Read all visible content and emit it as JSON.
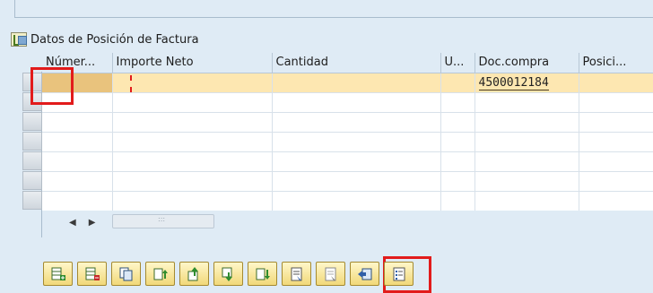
{
  "section": {
    "title": "Datos de Posición de Factura",
    "icon": "tree-structure-icon"
  },
  "table": {
    "columns": [
      "Númer...",
      "Importe Neto",
      "Cantidad",
      "U...",
      "Doc.compra",
      "Posici..."
    ],
    "rows": [
      [
        "",
        "",
        "",
        "",
        "4500012184",
        ""
      ],
      [
        "",
        "",
        "",
        "",
        "",
        ""
      ],
      [
        "",
        "",
        "",
        "",
        "",
        ""
      ],
      [
        "",
        "",
        "",
        "",
        "",
        ""
      ],
      [
        "",
        "",
        "",
        "",
        "",
        ""
      ],
      [
        "",
        "",
        "",
        "",
        "",
        ""
      ],
      [
        "",
        "",
        "",
        "",
        "",
        ""
      ]
    ]
  },
  "scroll": {
    "left_icon": "scroll-left-icon",
    "right_icon": "scroll-right-icon"
  },
  "toolbar": {
    "buttons": [
      "insert-row-icon",
      "delete-row-icon",
      "copy-row-icon",
      "sort-ascending-icon",
      "move-up-icon",
      "move-down-icon",
      "sort-descending-icon",
      "select-all-icon",
      "deselect-all-icon",
      "transfer-icon",
      "details-list-icon"
    ]
  },
  "colors": {
    "highlight": "#e21b1b",
    "active_row": "#fde7b1",
    "button_fill": "#f1d879",
    "background": "#dfebf5"
  }
}
